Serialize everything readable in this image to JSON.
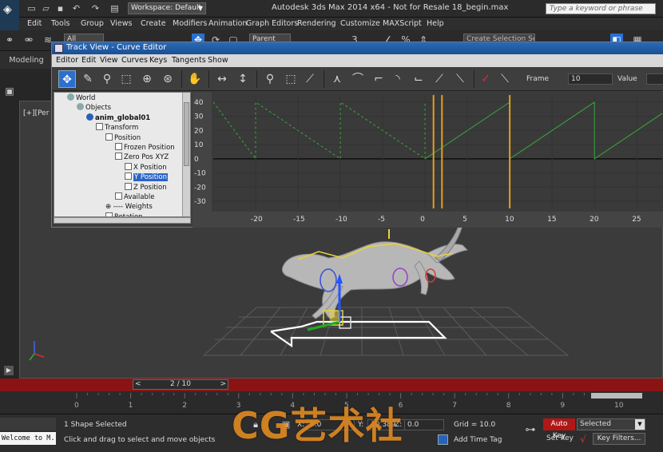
{
  "window": {
    "title": "Autodesk 3ds Max  2014 x64  - Not for Resale   18_begin.max",
    "workspace": "Workspace: Default",
    "search_placeholder": "Type a keyword or phrase"
  },
  "menu": [
    "Edit",
    "Tools",
    "Group",
    "Views",
    "Create",
    "Modifiers",
    "Animation",
    "Graph Editors",
    "Rendering",
    "Customize",
    "MAXScript",
    "Help"
  ],
  "toolbar": {
    "selection_filter": "All",
    "reference_coord": "Parent",
    "named_selection": "Create Selection Se"
  },
  "ribbon": {
    "tab": "Modeling"
  },
  "viewport": {
    "label": "[+][Per"
  },
  "curve_editor": {
    "title": "Track View - Curve Editor",
    "menu": [
      "Editor",
      "Edit",
      "View",
      "Curves",
      "Keys",
      "Tangents",
      "Show"
    ],
    "frame_label": "Frame",
    "frame_value": "10",
    "value_label": "Value",
    "tree": [
      {
        "label": "World",
        "indent": 0,
        "icon": "globe"
      },
      {
        "label": "Objects",
        "indent": 1,
        "icon": "globe"
      },
      {
        "label": "anim_global01",
        "indent": 2,
        "icon": "node",
        "bold": true
      },
      {
        "label": "Transform",
        "indent": 3,
        "icon": "box"
      },
      {
        "label": "Position",
        "indent": 4,
        "icon": "box"
      },
      {
        "label": "Frozen Position",
        "indent": 5,
        "icon": "box"
      },
      {
        "label": "Zero Pos XYZ",
        "indent": 5,
        "icon": "box"
      },
      {
        "label": "X Position",
        "indent": 6,
        "icon": "box"
      },
      {
        "label": "Y Position",
        "indent": 6,
        "icon": "box",
        "selected": true
      },
      {
        "label": "Z Position",
        "indent": 6,
        "icon": "box"
      },
      {
        "label": "Available",
        "indent": 5,
        "icon": "box"
      },
      {
        "label": "Weights",
        "indent": 4,
        "icon": "none"
      },
      {
        "label": "Rotation",
        "indent": 4,
        "icon": "box"
      }
    ]
  },
  "chart_data": {
    "type": "line",
    "x_ticks": [
      -20,
      -15,
      -10,
      -5,
      0,
      5,
      10,
      15,
      20,
      25
    ],
    "y_ticks": [
      40,
      30,
      20,
      10,
      0,
      -10,
      -20,
      -30
    ],
    "xlim": [
      -25,
      28
    ],
    "ylim": [
      -35,
      45
    ],
    "time_range_markers": [
      1,
      2
    ],
    "current_frame": 10,
    "series": [
      {
        "color": "#39a83a",
        "style": "dashed",
        "points": [
          [
            -25,
            40
          ],
          [
            -20,
            0
          ],
          [
            -20,
            40
          ],
          [
            -10,
            0
          ],
          [
            -10,
            40
          ],
          [
            0,
            0
          ],
          [
            0,
            40
          ]
        ]
      },
      {
        "color": "#39a83a",
        "style": "solid",
        "points": [
          [
            0,
            0
          ],
          [
            10,
            40
          ],
          [
            10,
            0
          ],
          [
            20,
            40
          ],
          [
            20,
            0
          ],
          [
            28,
            32
          ]
        ]
      }
    ]
  },
  "timeline": {
    "position": "2 / 10",
    "ticks": [
      "0",
      "1",
      "2",
      "3",
      "4",
      "5",
      "6",
      "7",
      "8",
      "9",
      "10"
    ]
  },
  "status": {
    "listener": "Welcome to M.",
    "selection": "1 Shape Selected",
    "prompt": "Click and drag to select and move objects",
    "x_label": "X:",
    "x_value": "0.0",
    "y_label": "Y:",
    "y_value": "10.389",
    "z_label": "Z:",
    "z_value": "0.0",
    "grid": "Grid = 10.0",
    "add_time_tag": "Add Time Tag",
    "auto_key": "Auto Key",
    "key_mode": "Selected",
    "set_key": "Set Key",
    "key_filters": "Key Filters..."
  },
  "watermark": "CG艺术社",
  "colors": {
    "auto_key_red": "#b01818",
    "timebar_red": "#8a1414",
    "selection_blue": "#2b64c8",
    "curve_green": "#39a83a",
    "range_orange": "#e0a020"
  }
}
